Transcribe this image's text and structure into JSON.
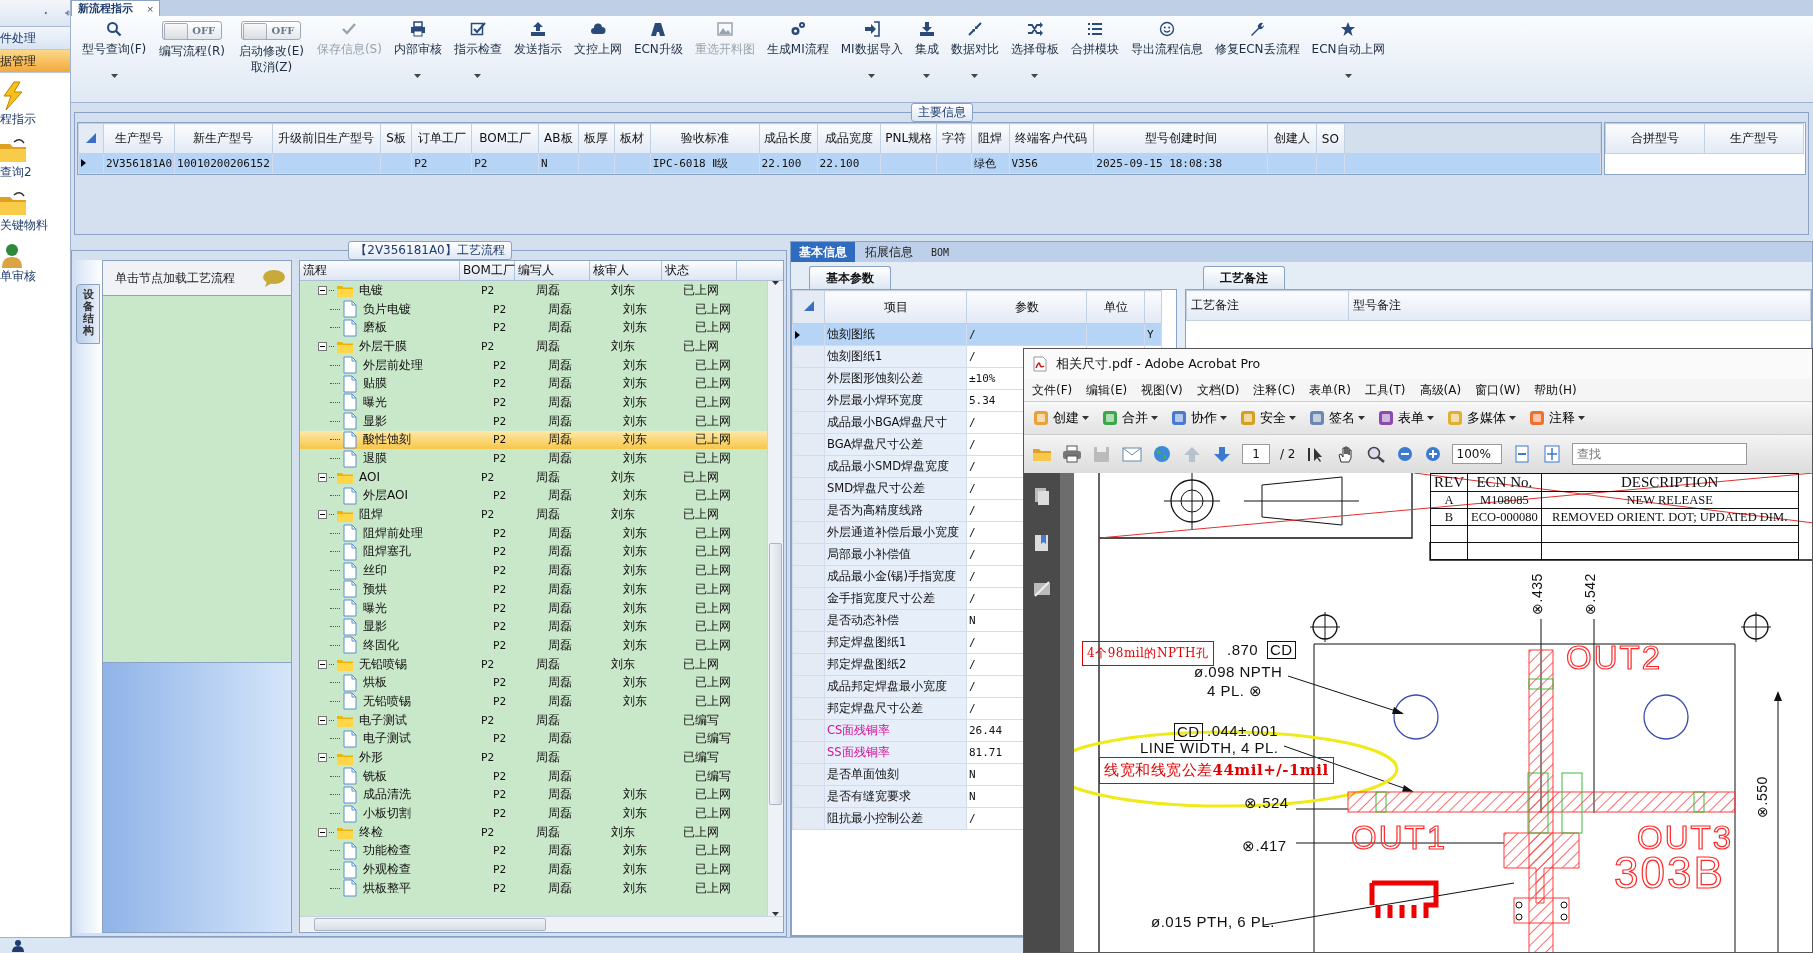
{
  "nav": {
    "items": [
      {
        "label": "件处理",
        "selected": false
      },
      {
        "label": "据管理",
        "selected": true
      }
    ],
    "shortcuts": [
      {
        "label": "程指示"
      },
      {
        "label": "查询2"
      },
      {
        "label": "关键物料"
      },
      {
        "label": "单审核"
      }
    ]
  },
  "document_tab": {
    "label": "新流程指示",
    "close": "×"
  },
  "toolbar": [
    {
      "kind": "button",
      "label": "型号查询(F)",
      "dropdown": true,
      "disabled": false
    },
    {
      "kind": "toggle",
      "switch_text": "OFF",
      "on": false,
      "label": "编写流程(R)"
    },
    {
      "kind": "toggle",
      "switch_text": "OFF",
      "on": false,
      "label": "启动修改(E)\n取消(Z)"
    },
    {
      "kind": "button",
      "label": "保存信息(S)",
      "dropdown": false,
      "disabled": true
    },
    {
      "kind": "button",
      "label": "内部审核",
      "dropdown": true,
      "disabled": false
    },
    {
      "kind": "button",
      "label": "指示检查",
      "dropdown": true,
      "disabled": false
    },
    {
      "kind": "button",
      "label": "发送指示",
      "dropdown": false,
      "disabled": false
    },
    {
      "kind": "button",
      "label": "文控上网",
      "dropdown": false,
      "disabled": false
    },
    {
      "kind": "button",
      "label": "ECN升级",
      "dropdown": false,
      "disabled": false
    },
    {
      "kind": "button",
      "label": "重选开料图",
      "dropdown": false,
      "disabled": true
    },
    {
      "kind": "button",
      "label": "生成MI流程",
      "dropdown": false,
      "disabled": false
    },
    {
      "kind": "button",
      "label": "MI数据导入",
      "dropdown": true,
      "disabled": false
    },
    {
      "kind": "button",
      "label": "集成",
      "dropdown": true,
      "disabled": false
    },
    {
      "kind": "button",
      "label": "数据对比",
      "dropdown": true,
      "disabled": false
    },
    {
      "kind": "button",
      "label": "选择母板",
      "dropdown": true,
      "disabled": false
    },
    {
      "kind": "button",
      "label": "合拼模块",
      "dropdown": false,
      "disabled": false
    },
    {
      "kind": "button",
      "label": "导出流程信息",
      "dropdown": false,
      "disabled": false
    },
    {
      "kind": "button",
      "label": "修复ECN丢流程",
      "dropdown": false,
      "disabled": false
    },
    {
      "kind": "button",
      "label": "ECN自动上网",
      "dropdown": true,
      "disabled": false
    }
  ],
  "main_info": {
    "title": "主要信息",
    "table": {
      "columns": [
        "生产型号",
        "新生产型号",
        "升级前旧生产型号",
        "S板",
        "订单工厂",
        "BOM工厂",
        "AB板",
        "板厚",
        "板材",
        "验收标准",
        "成品长度",
        "成品宽度",
        "PNL规格",
        "字符",
        "阻焊",
        "终端客户代码",
        "型号创建时间",
        "创建人",
        "SO"
      ],
      "rows": [
        {
          "selected": true,
          "cells": [
            "2V356181A0",
            "10010200206152",
            null,
            null,
            "P2",
            "P2",
            "N",
            null,
            null,
            "IPC-6018 Ⅱ级",
            "22.100",
            "22.100",
            null,
            null,
            "绿色",
            "V356",
            "2025-09-15 18:08:38",
            null,
            null
          ]
        }
      ]
    },
    "merge_table": {
      "columns": [
        "合拼型号",
        "生产型号"
      ]
    }
  },
  "process_panel": {
    "title": "【2V356181A0】工艺流程",
    "side_tab": "设备结构",
    "hint": "单击节点加载工艺流程",
    "tree": {
      "columns": [
        "流程",
        "BOM工厂",
        "编写人",
        "核审人",
        "状态"
      ],
      "nodes": [
        {
          "name": "电镀",
          "factory": "P2",
          "author": "周磊",
          "reviewer": "刘东",
          "status": "已上网",
          "selected": false,
          "expanded": true,
          "children": [
            {
              "name": "负片电镀",
              "factory": "P2",
              "author": "周磊",
              "reviewer": "刘东",
              "status": "已上网",
              "selected": false
            },
            {
              "name": "磨板",
              "factory": "P2",
              "author": "周磊",
              "reviewer": "刘东",
              "status": "已上网",
              "selected": false
            }
          ]
        },
        {
          "name": "外层干膜",
          "factory": "P2",
          "author": "周磊",
          "reviewer": "刘东",
          "status": "已上网",
          "selected": false,
          "expanded": true,
          "children": [
            {
              "name": "外层前处理",
              "factory": "P2",
              "author": "周磊",
              "reviewer": "刘东",
              "status": "已上网",
              "selected": false
            },
            {
              "name": "贴膜",
              "factory": "P2",
              "author": "周磊",
              "reviewer": "刘东",
              "status": "已上网",
              "selected": false
            },
            {
              "name": "曝光",
              "factory": "P2",
              "author": "周磊",
              "reviewer": "刘东",
              "status": "已上网",
              "selected": false
            },
            {
              "name": "显影",
              "factory": "P2",
              "author": "周磊",
              "reviewer": "刘东",
              "status": "已上网",
              "selected": false
            },
            {
              "name": "酸性蚀刻",
              "factory": "P2",
              "author": "周磊",
              "reviewer": "刘东",
              "status": "已上网",
              "selected": true
            },
            {
              "name": "退膜",
              "factory": "P2",
              "author": "周磊",
              "reviewer": "刘东",
              "status": "已上网",
              "selected": false
            }
          ]
        },
        {
          "name": "AOI",
          "factory": "P2",
          "author": "周磊",
          "reviewer": "刘东",
          "status": "已上网",
          "selected": false,
          "expanded": true,
          "children": [
            {
              "name": "外层AOI",
              "factory": "P2",
              "author": "周磊",
              "reviewer": "刘东",
              "status": "已上网",
              "selected": false
            }
          ]
        },
        {
          "name": "阻焊",
          "factory": "P2",
          "author": "周磊",
          "reviewer": "刘东",
          "status": "已上网",
          "selected": false,
          "expanded": true,
          "children": [
            {
              "name": "阻焊前处理",
              "factory": "P2",
              "author": "周磊",
              "reviewer": "刘东",
              "status": "已上网",
              "selected": false
            },
            {
              "name": "阻焊塞孔",
              "factory": "P2",
              "author": "周磊",
              "reviewer": "刘东",
              "status": "已上网",
              "selected": false
            },
            {
              "name": "丝印",
              "factory": "P2",
              "author": "周磊",
              "reviewer": "刘东",
              "status": "已上网",
              "selected": false
            },
            {
              "name": "预烘",
              "factory": "P2",
              "author": "周磊",
              "reviewer": "刘东",
              "status": "已上网",
              "selected": false
            },
            {
              "name": "曝光",
              "factory": "P2",
              "author": "周磊",
              "reviewer": "刘东",
              "status": "已上网",
              "selected": false
            },
            {
              "name": "显影",
              "factory": "P2",
              "author": "周磊",
              "reviewer": "刘东",
              "status": "已上网",
              "selected": false
            },
            {
              "name": "终固化",
              "factory": "P2",
              "author": "周磊",
              "reviewer": "刘东",
              "status": "已上网",
              "selected": false
            }
          ]
        },
        {
          "name": "无铅喷锡",
          "factory": "P2",
          "author": "周磊",
          "reviewer": "刘东",
          "status": "已上网",
          "selected": false,
          "expanded": true,
          "children": [
            {
              "name": "烘板",
              "factory": "P2",
              "author": "周磊",
              "reviewer": "刘东",
              "status": "已上网",
              "selected": false
            },
            {
              "name": "无铅喷锡",
              "factory": "P2",
              "author": "周磊",
              "reviewer": "刘东",
              "status": "已上网",
              "selected": false
            }
          ]
        },
        {
          "name": "电子测试",
          "factory": "P2",
          "author": "周磊",
          "status": "已编写",
          "selected": false,
          "expanded": true,
          "children": [
            {
              "name": "电子测试",
              "factory": "P2",
              "author": "周磊",
              "status": "已编写",
              "selected": false
            }
          ]
        },
        {
          "name": "外形",
          "factory": "P2",
          "author": "周磊",
          "status": "已编写",
          "selected": false,
          "expanded": true,
          "children": [
            {
              "name": "铣板",
              "factory": "P2",
              "author": "周磊",
              "status": "已编写",
              "selected": false
            },
            {
              "name": "成品清洗",
              "factory": "P2",
              "author": "周磊",
              "reviewer": "刘东",
              "status": "已上网",
              "selected": false
            },
            {
              "name": "小板切割",
              "factory": "P2",
              "author": "周磊",
              "reviewer": "刘东",
              "status": "已上网",
              "selected": false
            }
          ]
        },
        {
          "name": "终检",
          "factory": "P2",
          "author": "周磊",
          "reviewer": "刘东",
          "status": "已上网",
          "selected": false,
          "expanded": true,
          "children": [
            {
              "name": "功能检查",
              "factory": "P2",
              "author": "周磊",
              "reviewer": "刘东",
              "status": "已上网",
              "selected": false
            },
            {
              "name": "外观检查",
              "factory": "P2",
              "author": "周磊",
              "reviewer": "刘东",
              "status": "已上网",
              "selected": false
            },
            {
              "name": "烘板整平",
              "factory": "P2",
              "author": "周磊",
              "reviewer": "刘东",
              "status": "已上网",
              "selected": false
            }
          ]
        }
      ]
    }
  },
  "detail_tabs": [
    {
      "label": "基本信息",
      "selected": true
    },
    {
      "label": "拓展信息",
      "selected": false
    },
    {
      "label": "BOM",
      "selected": false
    }
  ],
  "basic_params": {
    "tab": "基本参数",
    "columns": [
      "项目",
      "参数",
      "单位"
    ],
    "rows": [
      {
        "item": "蚀刻图纸",
        "value": "/",
        "column_4": "Y",
        "selected": true
      },
      {
        "item": "蚀刻图纸1",
        "value": "/",
        "selected": false
      },
      {
        "item": "外层图形蚀刻公差",
        "value": "±10%",
        "selected": false
      },
      {
        "item": "外层最小焊环宽度",
        "value": "5.34",
        "selected": false
      },
      {
        "item": "成品最小BGA焊盘尺寸",
        "value": "/",
        "selected": false
      },
      {
        "item": "BGA焊盘尺寸公差",
        "value": "/",
        "selected": false
      },
      {
        "item": "成品最小SMD焊盘宽度",
        "value": "/",
        "selected": false
      },
      {
        "item": "SMD焊盘尺寸公差",
        "value": "/",
        "selected": false
      },
      {
        "item": "是否为高精度线路",
        "value": "/",
        "selected": false
      },
      {
        "item": "外层通道补偿后最小宽度",
        "value": "/",
        "selected": false
      },
      {
        "item": "局部最小补偿值",
        "value": "/",
        "selected": false
      },
      {
        "item": "成品最小金(锡)手指宽度",
        "value": "/",
        "selected": false
      },
      {
        "item": "金手指宽度尺寸公差",
        "value": "/",
        "selected": false
      },
      {
        "item": "是否动态补偿",
        "value": "N",
        "selected": false
      },
      {
        "item": "邦定焊盘图纸1",
        "value": "/",
        "selected": false
      },
      {
        "item": "邦定焊盘图纸2",
        "value": "/",
        "selected": false
      },
      {
        "item": "成品邦定焊盘最小宽度",
        "value": "/",
        "selected": false
      },
      {
        "item": "邦定焊盘尺寸公差",
        "value": "/",
        "selected": false
      },
      {
        "item": "CS面残铜率",
        "value": "26.44",
        "color": "#d6109a",
        "selected": false
      },
      {
        "item": "SS面残铜率",
        "value": "81.71",
        "color": "#d6109a",
        "selected": false
      },
      {
        "item": "是否单面蚀刻",
        "value": "N",
        "selected": false
      },
      {
        "item": "是否有缝宽要求",
        "value": "N",
        "selected": false
      },
      {
        "item": "阻抗最小控制公差",
        "value": "/",
        "selected": false
      }
    ]
  },
  "process_notes": {
    "tab": "工艺备注",
    "columns": [
      "工艺备注",
      "型号备注"
    ]
  },
  "acrobat": {
    "title": "相关尺寸.pdf - Adobe Acrobat Pro",
    "menu": [
      "文件(F)",
      "编辑(E)",
      "视图(V)",
      "文档(D)",
      "注释(C)",
      "表单(R)",
      "工具(T)",
      "高级(A)",
      "窗口(W)",
      "帮助(H)"
    ],
    "tools": [
      "创建",
      "合并",
      "协作",
      "安全",
      "签名",
      "表单",
      "多媒体",
      "注释"
    ],
    "page": "1",
    "page_count": "/ 2",
    "zoom": "100%",
    "search_placeholder": "查找",
    "document": {
      "revision_table": {
        "columns": [
          "REV",
          "ECN No.",
          "DESCRIPTION"
        ],
        "rows": [
          [
            "A",
            "M108085",
            "NEW RELEASE"
          ],
          [
            "B",
            "ECO-000080",
            "REMOVED ORIENT. DOT; UPDATED DIM."
          ]
        ]
      },
      "labels": [
        {
          "text": "⊗.435",
          "kind": "vertical"
        },
        {
          "text": "⊗.542",
          "kind": "vertical"
        },
        {
          "text": "4个98mil的NPTH孔",
          "kind": "note"
        },
        {
          "text": ".870",
          "kind": "plain"
        },
        {
          "text": "CD",
          "kind": "boxed"
        },
        {
          "text": "ø.098 NPTH",
          "kind": "plain"
        },
        {
          "text": "4 PL. ⊗",
          "kind": "plain"
        },
        {
          "text": "CD",
          "kind": "boxed"
        },
        {
          "text": ".044±.001",
          "kind": "plain"
        },
        {
          "text": "LINE WIDTH, 4 PL.",
          "kind": "plain"
        },
        {
          "text": "线宽和线宽公差**44mil+/-1mil**",
          "kind": "note"
        },
        {
          "text": "⊗.524",
          "kind": "plain"
        },
        {
          "text": "OUT2",
          "kind": "outline"
        },
        {
          "text": "⊗.417",
          "kind": "plain"
        },
        {
          "text": "OUT1",
          "kind": "outline"
        },
        {
          "text": "OUT3",
          "kind": "outline"
        },
        {
          "text": "303B",
          "kind": "outline"
        },
        {
          "text": "ø.015 PTH, 6 PL.",
          "kind": "plain"
        },
        {
          "text": "⊗.550",
          "kind": "vertical"
        }
      ]
    }
  }
}
